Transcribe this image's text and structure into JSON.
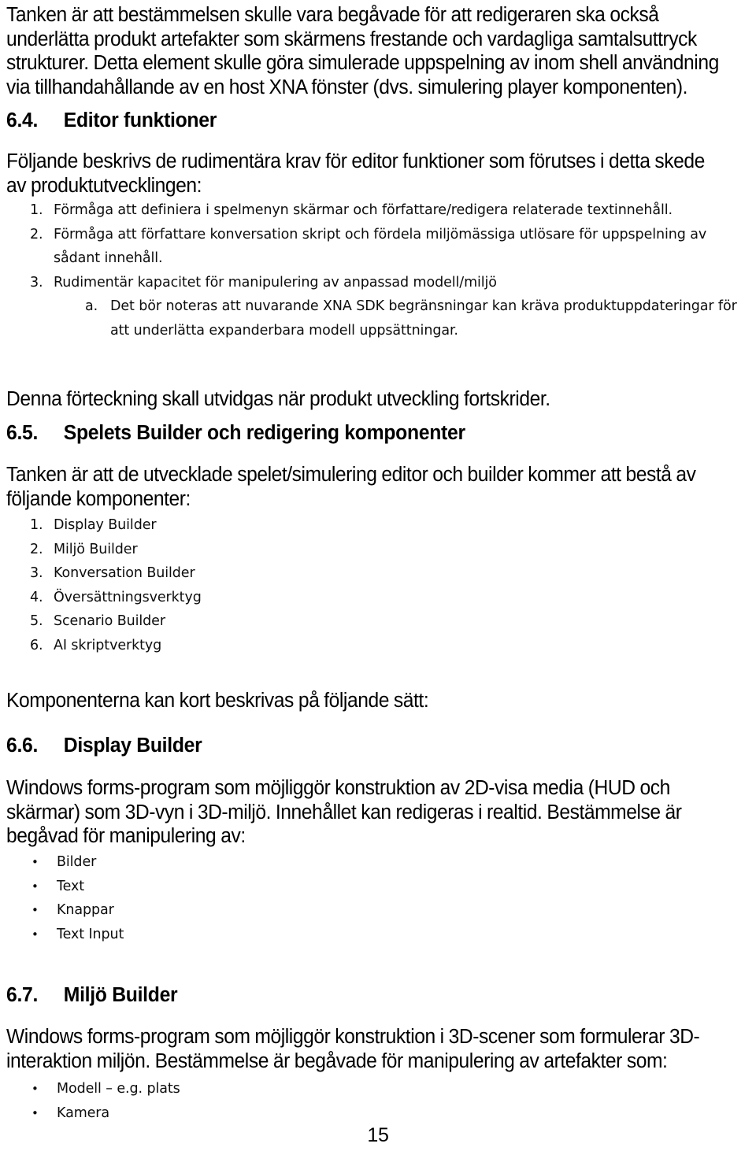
{
  "document": {
    "page_number": "15",
    "sections": [
      {
        "id": "intro",
        "paragraph": "Tanken är att bestämmelsen skulle vara begåvade för att redigeraren ska också underlätta produkt artefakter som skärmens frestande och vardagliga samtalsuttryck strukturer. Detta element skulle göra simulerade uppspelning av inom shell användning via tillhandahållande av en host XNA fönster (dvs. simulering player komponenten)."
      }
    ],
    "s64": {
      "number": "6.4.",
      "title": "Editor funktioner",
      "intro": "Följande beskrivs de rudimentära krav för editor funktioner som förutses i detta skede av produktutvecklingen:",
      "items": [
        {
          "marker": "1.",
          "text": "Förmåga att definiera i spelmenyn skärmar och författare/redigera relaterade textinnehåll."
        },
        {
          "marker": "2.",
          "text": "Förmåga att författare konversation skript och fördela miljömässiga utlösare för uppspelning av sådant innehåll."
        },
        {
          "marker": "3.",
          "text": "Rudimentär kapacitet för manipulering av anpassad modell/miljö"
        }
      ],
      "subitems": [
        {
          "marker": "a.",
          "text": "Det bör noteras att nuvarande XNA SDK begränsningar kan kräva produktuppdateringar för att underlätta expanderbara modell uppsättningar."
        }
      ],
      "closing": "Denna förteckning skall utvidgas när produkt utveckling fortskrider."
    },
    "s65": {
      "number": "6.5.",
      "title": "Spelets Builder och redigering komponenter",
      "intro": "Tanken är att de utvecklade spelet/simulering editor och builder kommer att bestå av följande komponenter:",
      "items": [
        {
          "marker": "1.",
          "text": "Display Builder"
        },
        {
          "marker": "2.",
          "text": "Miljö Builder"
        },
        {
          "marker": "3.",
          "text": "Konversation Builder"
        },
        {
          "marker": "4.",
          "text": "Översättningsverktyg"
        },
        {
          "marker": "5.",
          "text": " Scenario Builder"
        },
        {
          "marker": "6.",
          "text": "AI skriptverktyg"
        }
      ],
      "closing": "Komponenterna kan kort beskrivas på följande sätt:"
    },
    "s66": {
      "number": "6.6.",
      "title": "Display Builder",
      "intro": "Windows forms-program som möjliggör konstruktion av 2D-visa media (HUD och skärmar) som 3D-vyn i 3D-miljö. Innehållet kan redigeras i realtid. Bestämmelse är begåvad för manipulering av:",
      "bullet": "•",
      "items": [
        {
          "text": "Bilder"
        },
        {
          "text": "Text"
        },
        {
          "text": "Knappar"
        },
        {
          "text": "Text Input"
        }
      ]
    },
    "s67": {
      "number": "6.7.",
      "title": "Miljö Builder",
      "intro": "Windows forms-program som möjliggör konstruktion i 3D-scener som formulerar 3D-interaktion miljön.  Bestämmelse är begåvade för manipulering av artefakter som:",
      "bullet": "•",
      "items": [
        {
          "text": "Modell – e.g. plats"
        },
        {
          "text": "Kamera"
        }
      ]
    }
  }
}
